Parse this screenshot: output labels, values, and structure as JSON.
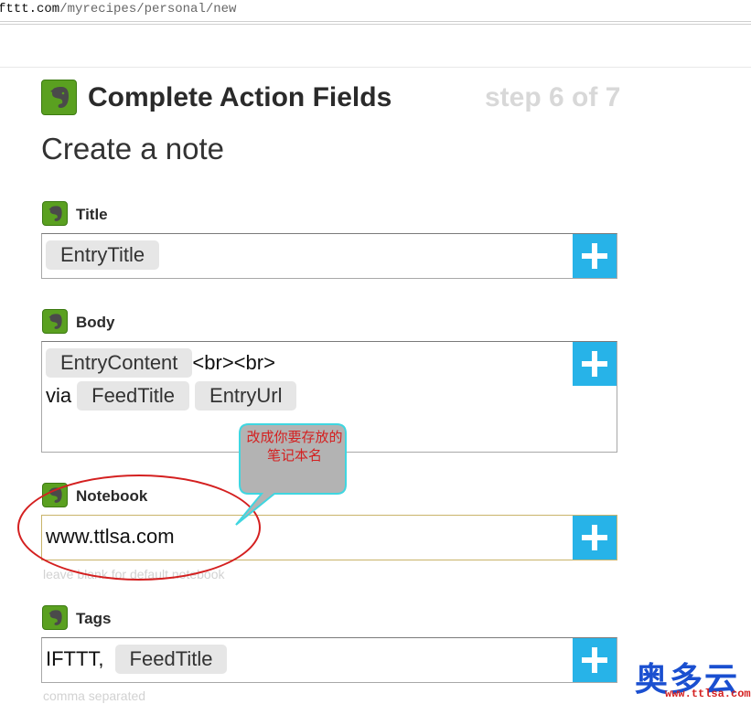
{
  "browser": {
    "url_host": "fttt.com",
    "url_path": "/myrecipes/personal/new"
  },
  "header": {
    "title": "Complete Action Fields",
    "step": "step 6 of 7",
    "subtitle": "Create a note"
  },
  "fields": {
    "title": {
      "label": "Title",
      "pills": [
        "EntryTitle"
      ]
    },
    "body": {
      "label": "Body",
      "pill1": "EntryContent",
      "text1": "<br><br>",
      "text2": "via",
      "pill2": "FeedTitle",
      "pill3": "EntryUrl"
    },
    "notebook": {
      "label": "Notebook",
      "value": "www.ttlsa.com",
      "hint": "leave blank for default notebook"
    },
    "tags": {
      "label": "Tags",
      "text": "IFTTT,",
      "pill": "FeedTitle",
      "hint": "comma separated"
    }
  },
  "annotation": {
    "text": "改成你要存放的笔记本名",
    "color": "#d42020"
  },
  "watermark": {
    "main": "奥多云",
    "sub": "www.ttlsa.com"
  },
  "colors": {
    "plus_button": "#27b3e8",
    "evernote_green": "#5aa020",
    "step_text": "#d8d8d8"
  },
  "icons": {
    "logo": "evernote-elephant-icon",
    "add": "plus-icon"
  }
}
